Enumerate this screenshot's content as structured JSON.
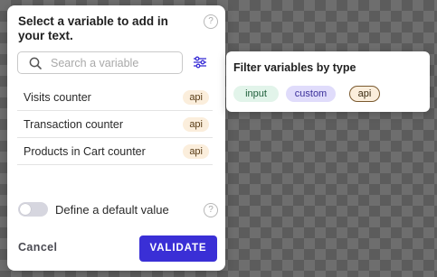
{
  "panel": {
    "title": "Select a variable to add in your text.",
    "help_glyph": "?",
    "search": {
      "placeholder": "Search a variable",
      "value": ""
    },
    "variables": [
      {
        "label": "Visits counter",
        "badge": "api"
      },
      {
        "label": "Transaction counter",
        "badge": "api"
      },
      {
        "label": "Products in Cart counter",
        "badge": "api"
      }
    ],
    "default_value": {
      "label": "Define a default value",
      "enabled": false
    },
    "cancel_label": "Cancel",
    "validate_label": "VALIDATE"
  },
  "filter_popover": {
    "title": "Filter variables by type",
    "chips": [
      {
        "label": "input",
        "selected": false
      },
      {
        "label": "custom",
        "selected": false
      },
      {
        "label": "api",
        "selected": true
      }
    ]
  },
  "icons": {
    "search": "search-icon",
    "filter": "sliders-icon",
    "help": "question-circle-icon"
  },
  "colors": {
    "accent": "#3a2fd6",
    "api_badge_bg": "#fbeedc",
    "input_chip_bg": "#e2f4ea",
    "custom_chip_bg": "#e0dcfb"
  }
}
